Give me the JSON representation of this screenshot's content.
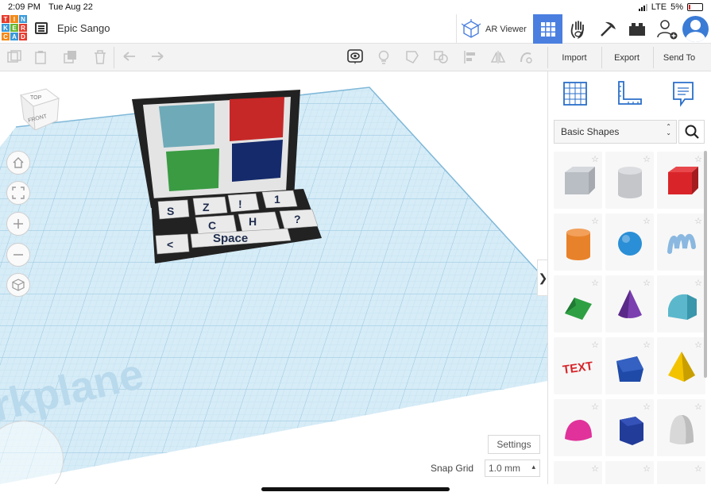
{
  "status_bar": {
    "time": "2:09 PM",
    "date": "Tue Aug 22",
    "network": "LTE",
    "battery": "5%"
  },
  "header": {
    "logo_letters": [
      "T",
      "I",
      "N",
      "K",
      "E",
      "R",
      "C",
      "A",
      "D"
    ],
    "logo_colors": [
      "#e63c2e",
      "#f28a1a",
      "#3a9ad9",
      "#3a9ad9",
      "#67b831",
      "#e63c2e",
      "#f28a1a",
      "#3a9ad9",
      "#e63c2e"
    ],
    "project_name": "Epic Sango",
    "ar_viewer_label": "AR Viewer"
  },
  "toolbar": {
    "import_label": "Import",
    "export_label": "Export",
    "send_to_label": "Send To"
  },
  "canvas": {
    "viewcube_top": "TOP",
    "viewcube_front": "FRONT",
    "workplane_text": "rkplane",
    "model_keys": [
      "S",
      "Z",
      "!",
      "1",
      "C",
      "H",
      "?",
      "<",
      "Space"
    ],
    "settings_label": "Settings",
    "snap_grid_label": "Snap Grid",
    "snap_grid_value": "1.0 mm"
  },
  "panel": {
    "category": "Basic Shapes",
    "shapes": [
      {
        "name": "box-hole",
        "color": "#b9bdc4"
      },
      {
        "name": "cylinder-hole",
        "color": "#c4c6ca"
      },
      {
        "name": "box",
        "color": "#d9252a"
      },
      {
        "name": "cylinder",
        "color": "#e8822a"
      },
      {
        "name": "sphere",
        "color": "#2a8fd6"
      },
      {
        "name": "scribble",
        "color": "#8ab8e0"
      },
      {
        "name": "roof",
        "color": "#2ea043"
      },
      {
        "name": "cone",
        "color": "#7b3fb0"
      },
      {
        "name": "round-roof",
        "color": "#5bb8cc"
      },
      {
        "name": "text",
        "color": "#d6252a"
      },
      {
        "name": "polygon",
        "color": "#1f4aa8"
      },
      {
        "name": "pyramid",
        "color": "#f3c300"
      },
      {
        "name": "half-sphere",
        "color": "#e0329a"
      },
      {
        "name": "polygon-prism",
        "color": "#223c9a"
      },
      {
        "name": "paraboloid",
        "color": "#d8d8d8"
      },
      {
        "name": "torus",
        "color": "#2a8fd6"
      },
      {
        "name": "tube",
        "color": "#e8822a"
      },
      {
        "name": "shape",
        "color": "#a06a3a"
      }
    ]
  },
  "colors": {
    "accent": "#4a7fe0",
    "grid": "#b9dcef"
  }
}
